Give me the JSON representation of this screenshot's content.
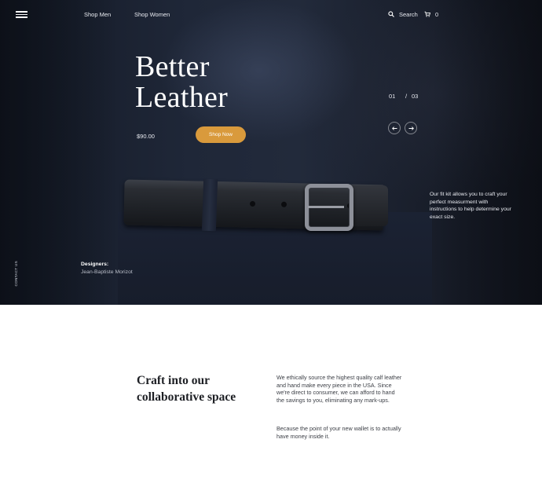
{
  "nav": {
    "links": [
      "Shop Men",
      "Shop Women"
    ],
    "search_label": "Search",
    "cart_count": "0"
  },
  "hero": {
    "title_line1": "Better",
    "title_line2": "Leather",
    "price": "$90.00",
    "cta_label": "Shop Now",
    "slide_current": "01",
    "slide_separator": "/",
    "slide_total": "03",
    "fit_text": "Our fit kit allows you to craft your perfect measurment with instructions to help determine your exact size.",
    "contact_label": "CONTACT US",
    "designers_label": "Designers:",
    "designers_name": "Jean-Baptiste Morizot"
  },
  "section": {
    "title": "Craft into our collaborative space",
    "paragraph1": "We ethically source the highest quality calf leather and hand make every piece in the USA. Since we're direct to consumer, we can afford to hand the savings to you, eliminating any mark-ups.",
    "paragraph2": "Because the point of your new wallet is to actually have money inside it."
  },
  "colors": {
    "accent": "#d99a3c",
    "hero_bg": "#1f2738"
  },
  "icons": [
    "menu-icon",
    "search-icon",
    "cart-icon",
    "arrow-left-icon",
    "arrow-right-icon"
  ]
}
